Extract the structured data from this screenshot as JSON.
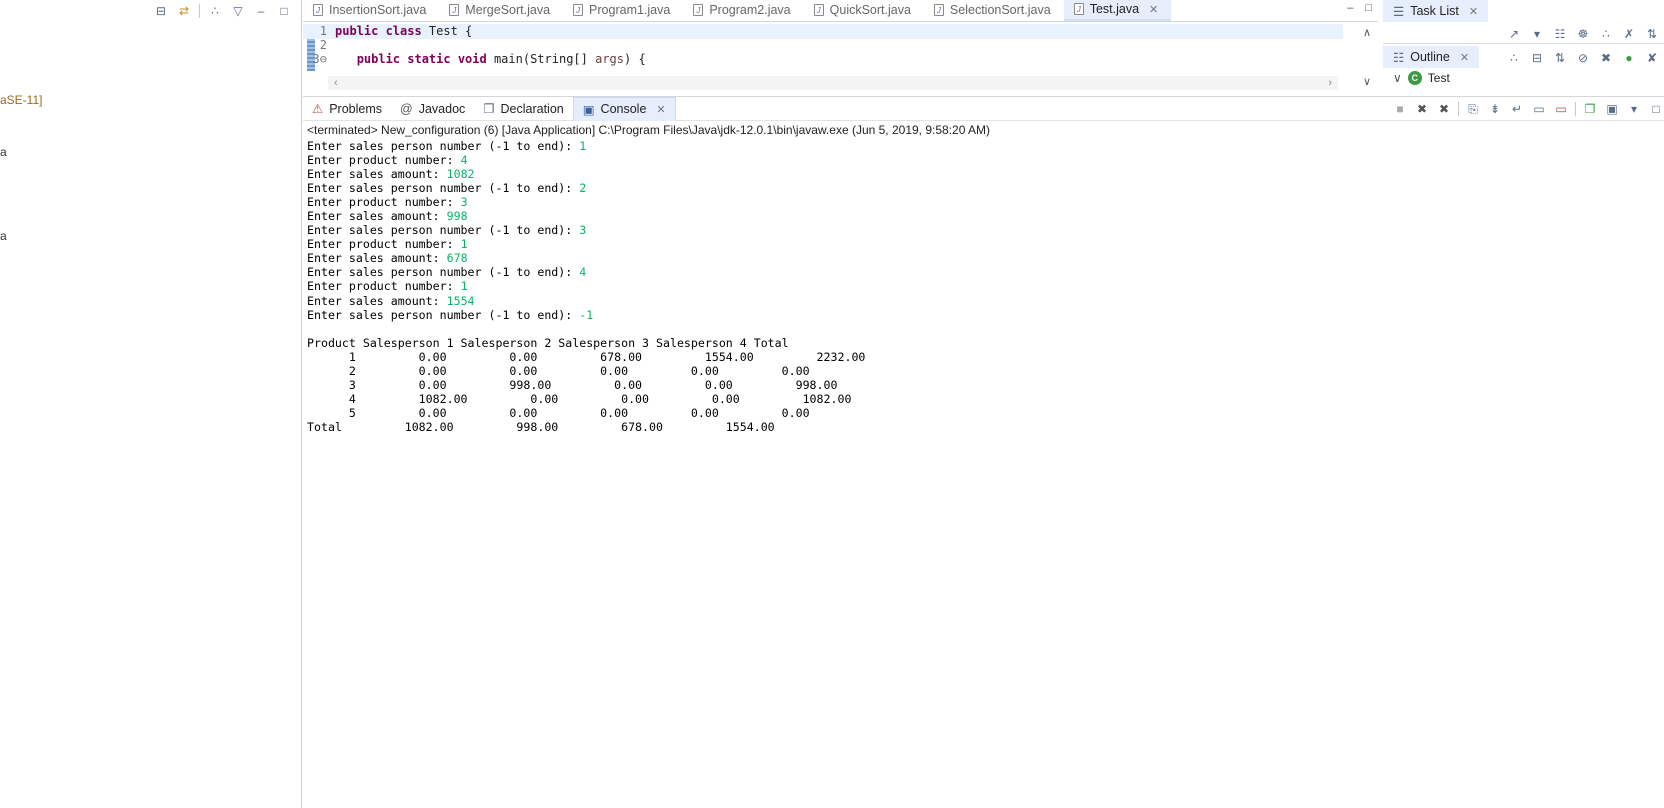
{
  "left_panel": {
    "fragments": [
      "aSE-11]",
      "a",
      "a"
    ]
  },
  "editor": {
    "tabs": [
      {
        "label": "InsertionSort.java",
        "active": false
      },
      {
        "label": "MergeSort.java",
        "active": false
      },
      {
        "label": "Program1.java",
        "active": false
      },
      {
        "label": "Program2.java",
        "active": false
      },
      {
        "label": "QuickSort.java",
        "active": false
      },
      {
        "label": "SelectionSort.java",
        "active": false
      },
      {
        "label": "Test.java",
        "active": true
      }
    ],
    "lines": [
      {
        "num": "1",
        "kw": "public class",
        "rest": " Test {"
      },
      {
        "num": "2",
        "kw": "",
        "rest": ""
      },
      {
        "num": "3⊖",
        "kw": "public static void",
        "rest": " main(String[] ",
        "param": "args",
        "tail": ") {"
      }
    ]
  },
  "task_list": {
    "tab_label": "Task List"
  },
  "outline": {
    "tab_label": "Outline",
    "item": "Test"
  },
  "console_view": {
    "tabs": [
      {
        "label": "Problems",
        "icon": "problems-icon",
        "active": false
      },
      {
        "label": "Javadoc",
        "icon": "javadoc-icon",
        "active": false
      },
      {
        "label": "Declaration",
        "icon": "declaration-icon",
        "active": false
      },
      {
        "label": "Console",
        "icon": "console-icon",
        "active": true
      }
    ],
    "header": "<terminated> New_configuration (6) [Java Application] C:\\Program Files\\Java\\jdk-12.0.1\\bin\\javaw.exe (Jun 5, 2019, 9:58:20 AM)",
    "io": [
      {
        "prompt": "Enter sales person number (-1 to end): ",
        "input": "1"
      },
      {
        "prompt": "Enter product number: ",
        "input": "4"
      },
      {
        "prompt": "Enter sales amount: ",
        "input": "1082"
      },
      {
        "prompt": "Enter sales person number (-1 to end): ",
        "input": "2"
      },
      {
        "prompt": "Enter product number: ",
        "input": "3"
      },
      {
        "prompt": "Enter sales amount: ",
        "input": "998"
      },
      {
        "prompt": "Enter sales person number (-1 to end): ",
        "input": "3"
      },
      {
        "prompt": "Enter product number: ",
        "input": "1"
      },
      {
        "prompt": "Enter sales amount: ",
        "input": "678"
      },
      {
        "prompt": "Enter sales person number (-1 to end): ",
        "input": "4"
      },
      {
        "prompt": "Enter product number: ",
        "input": "1"
      },
      {
        "prompt": "Enter sales amount: ",
        "input": "1554"
      },
      {
        "prompt": "Enter sales person number (-1 to end): ",
        "input": "-1"
      }
    ],
    "table_header": "Product Salesperson 1 Salesperson 2 Salesperson 3 Salesperson 4 Total",
    "table_rows": [
      "      1         0.00         0.00         678.00         1554.00         2232.00",
      "      2         0.00         0.00         0.00         0.00         0.00",
      "      3         0.00         998.00         0.00         0.00         998.00",
      "      4         1082.00         0.00         0.00         0.00         1082.00",
      "      5         0.00         0.00         0.00         0.00         0.00",
      "Total         1082.00         998.00         678.00         1554.00"
    ]
  }
}
